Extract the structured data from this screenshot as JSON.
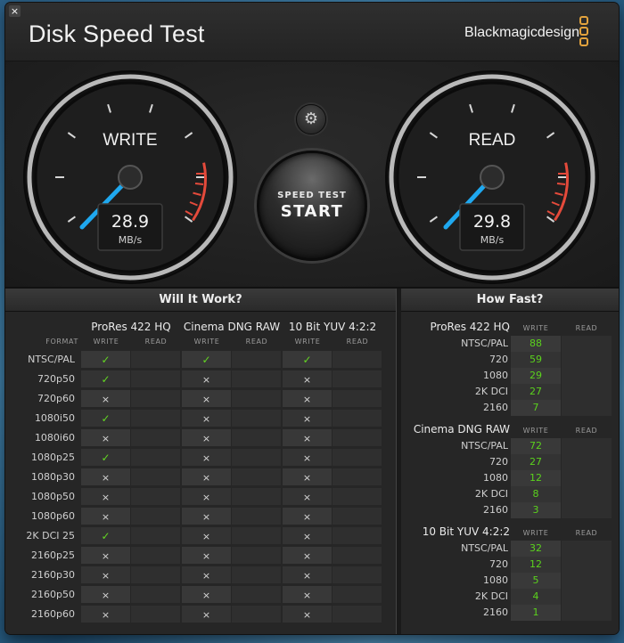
{
  "window": {
    "title": "Disk Speed Test",
    "brand": "Blackmagicdesign",
    "close_glyph": "×",
    "settings_glyph": "⚙"
  },
  "gauges": {
    "write": {
      "label": "WRITE",
      "value": "28.9",
      "unit": "MB/s"
    },
    "read": {
      "label": "READ",
      "value": "29.8",
      "unit": "MB/s"
    }
  },
  "start_button": {
    "line1": "SPEED TEST",
    "line2": "START"
  },
  "will_it_work": {
    "header": "Will It Work?",
    "format_label": "FORMAT",
    "write_label": "WRITE",
    "read_label": "READ",
    "groups": [
      "ProRes 422 HQ",
      "Cinema DNG RAW",
      "10 Bit YUV 4:2:2"
    ],
    "rows": [
      {
        "format": "NTSC/PAL",
        "marks": [
          "✓",
          "✓",
          "✓"
        ]
      },
      {
        "format": "720p50",
        "marks": [
          "✓",
          "×",
          "×"
        ]
      },
      {
        "format": "720p60",
        "marks": [
          "×",
          "×",
          "×"
        ]
      },
      {
        "format": "1080i50",
        "marks": [
          "✓",
          "×",
          "×"
        ]
      },
      {
        "format": "1080i60",
        "marks": [
          "×",
          "×",
          "×"
        ]
      },
      {
        "format": "1080p25",
        "marks": [
          "✓",
          "×",
          "×"
        ]
      },
      {
        "format": "1080p30",
        "marks": [
          "×",
          "×",
          "×"
        ]
      },
      {
        "format": "1080p50",
        "marks": [
          "×",
          "×",
          "×"
        ]
      },
      {
        "format": "1080p60",
        "marks": [
          "×",
          "×",
          "×"
        ]
      },
      {
        "format": "2K DCI 25",
        "marks": [
          "✓",
          "×",
          "×"
        ]
      },
      {
        "format": "2160p25",
        "marks": [
          "×",
          "×",
          "×"
        ]
      },
      {
        "format": "2160p30",
        "marks": [
          "×",
          "×",
          "×"
        ]
      },
      {
        "format": "2160p50",
        "marks": [
          "×",
          "×",
          "×"
        ]
      },
      {
        "format": "2160p60",
        "marks": [
          "×",
          "×",
          "×"
        ]
      }
    ]
  },
  "how_fast": {
    "header": "How Fast?",
    "write_label": "WRITE",
    "read_label": "READ",
    "groups": [
      {
        "name": "ProRes 422 HQ",
        "rows": [
          {
            "format": "NTSC/PAL",
            "write": "88"
          },
          {
            "format": "720",
            "write": "59"
          },
          {
            "format": "1080",
            "write": "29"
          },
          {
            "format": "2K DCI",
            "write": "27"
          },
          {
            "format": "2160",
            "write": "7"
          }
        ]
      },
      {
        "name": "Cinema DNG RAW",
        "rows": [
          {
            "format": "NTSC/PAL",
            "write": "72"
          },
          {
            "format": "720",
            "write": "27"
          },
          {
            "format": "1080",
            "write": "12"
          },
          {
            "format": "2K DCI",
            "write": "8"
          },
          {
            "format": "2160",
            "write": "3"
          }
        ]
      },
      {
        "name": "10 Bit YUV 4:2:2",
        "rows": [
          {
            "format": "NTSC/PAL",
            "write": "32"
          },
          {
            "format": "720",
            "write": "12"
          },
          {
            "format": "1080",
            "write": "5"
          },
          {
            "format": "2K DCI",
            "write": "4"
          },
          {
            "format": "2160",
            "write": "1"
          }
        ]
      }
    ]
  },
  "colors": {
    "accent_needle": "#1fa8ef",
    "check": "#63d623",
    "speed_value": "#5bd21d",
    "brand_logo": "#e3a33d"
  }
}
